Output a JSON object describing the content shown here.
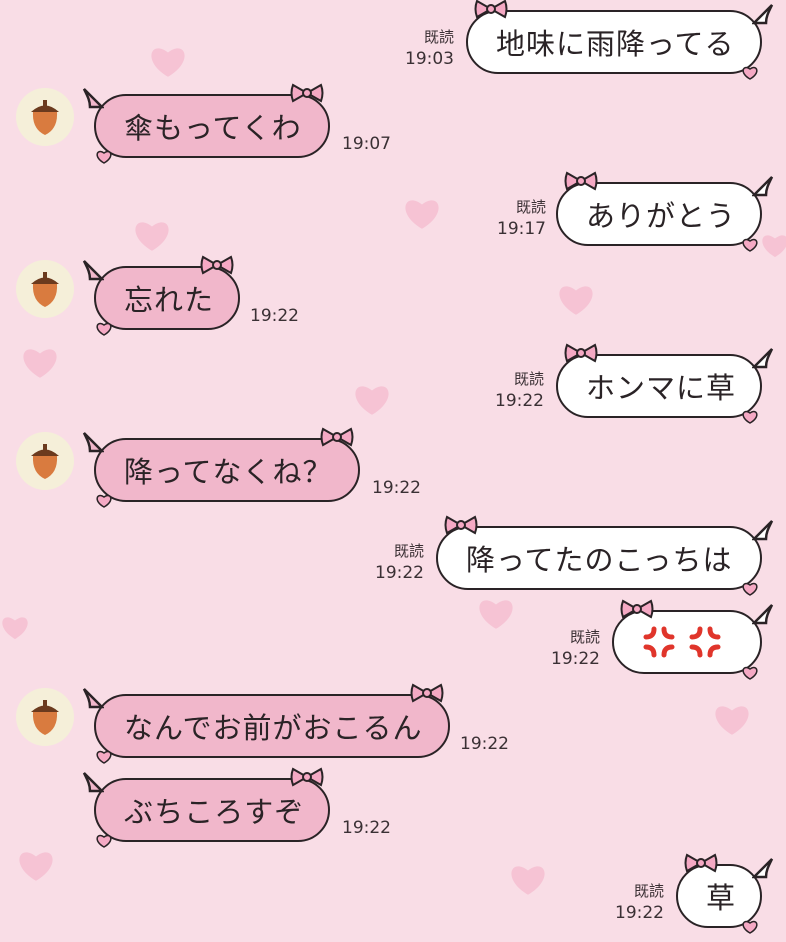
{
  "messages": [
    {
      "side": "out",
      "text": "地味に雨降ってる",
      "read": "既読",
      "time": "19:03"
    },
    {
      "side": "in",
      "text": "傘もってくわ",
      "time": "19:07",
      "avatar": "acorn-icon"
    },
    {
      "side": "out",
      "text": "ありがとう",
      "read": "既読",
      "time": "19:17"
    },
    {
      "side": "in",
      "text": "忘れた",
      "time": "19:22",
      "avatar": "acorn-icon"
    },
    {
      "side": "out",
      "text": "ホンマに草",
      "read": "既読",
      "time": "19:22"
    },
    {
      "side": "in",
      "text": "降ってなくね？",
      "time": "19:22",
      "avatar": "acorn-icon"
    },
    {
      "side": "out",
      "text": "降ってたのこっちは",
      "read": "既読",
      "time": "19:22"
    },
    {
      "side": "out",
      "emoji": [
        "anger-symbol-icon",
        "anger-symbol-icon"
      ],
      "read": "既読",
      "time": "19:22"
    },
    {
      "side": "in",
      "text": "なんでお前がおこるん",
      "time": "19:22",
      "avatar": "acorn-icon"
    },
    {
      "side": "in",
      "text": "ぶちころすぞ",
      "time": "19:22"
    },
    {
      "side": "out",
      "text": "草",
      "read": "既読",
      "time": "19:22"
    }
  ],
  "colors": {
    "background": "#f9dde6",
    "incoming_bubble": "#f1b7cb",
    "outgoing_bubble": "#ffffff",
    "outline": "#2a2326",
    "anger": "#e0352b"
  },
  "decorations": [
    "heart-icon",
    "ribbon-bow-icon"
  ]
}
